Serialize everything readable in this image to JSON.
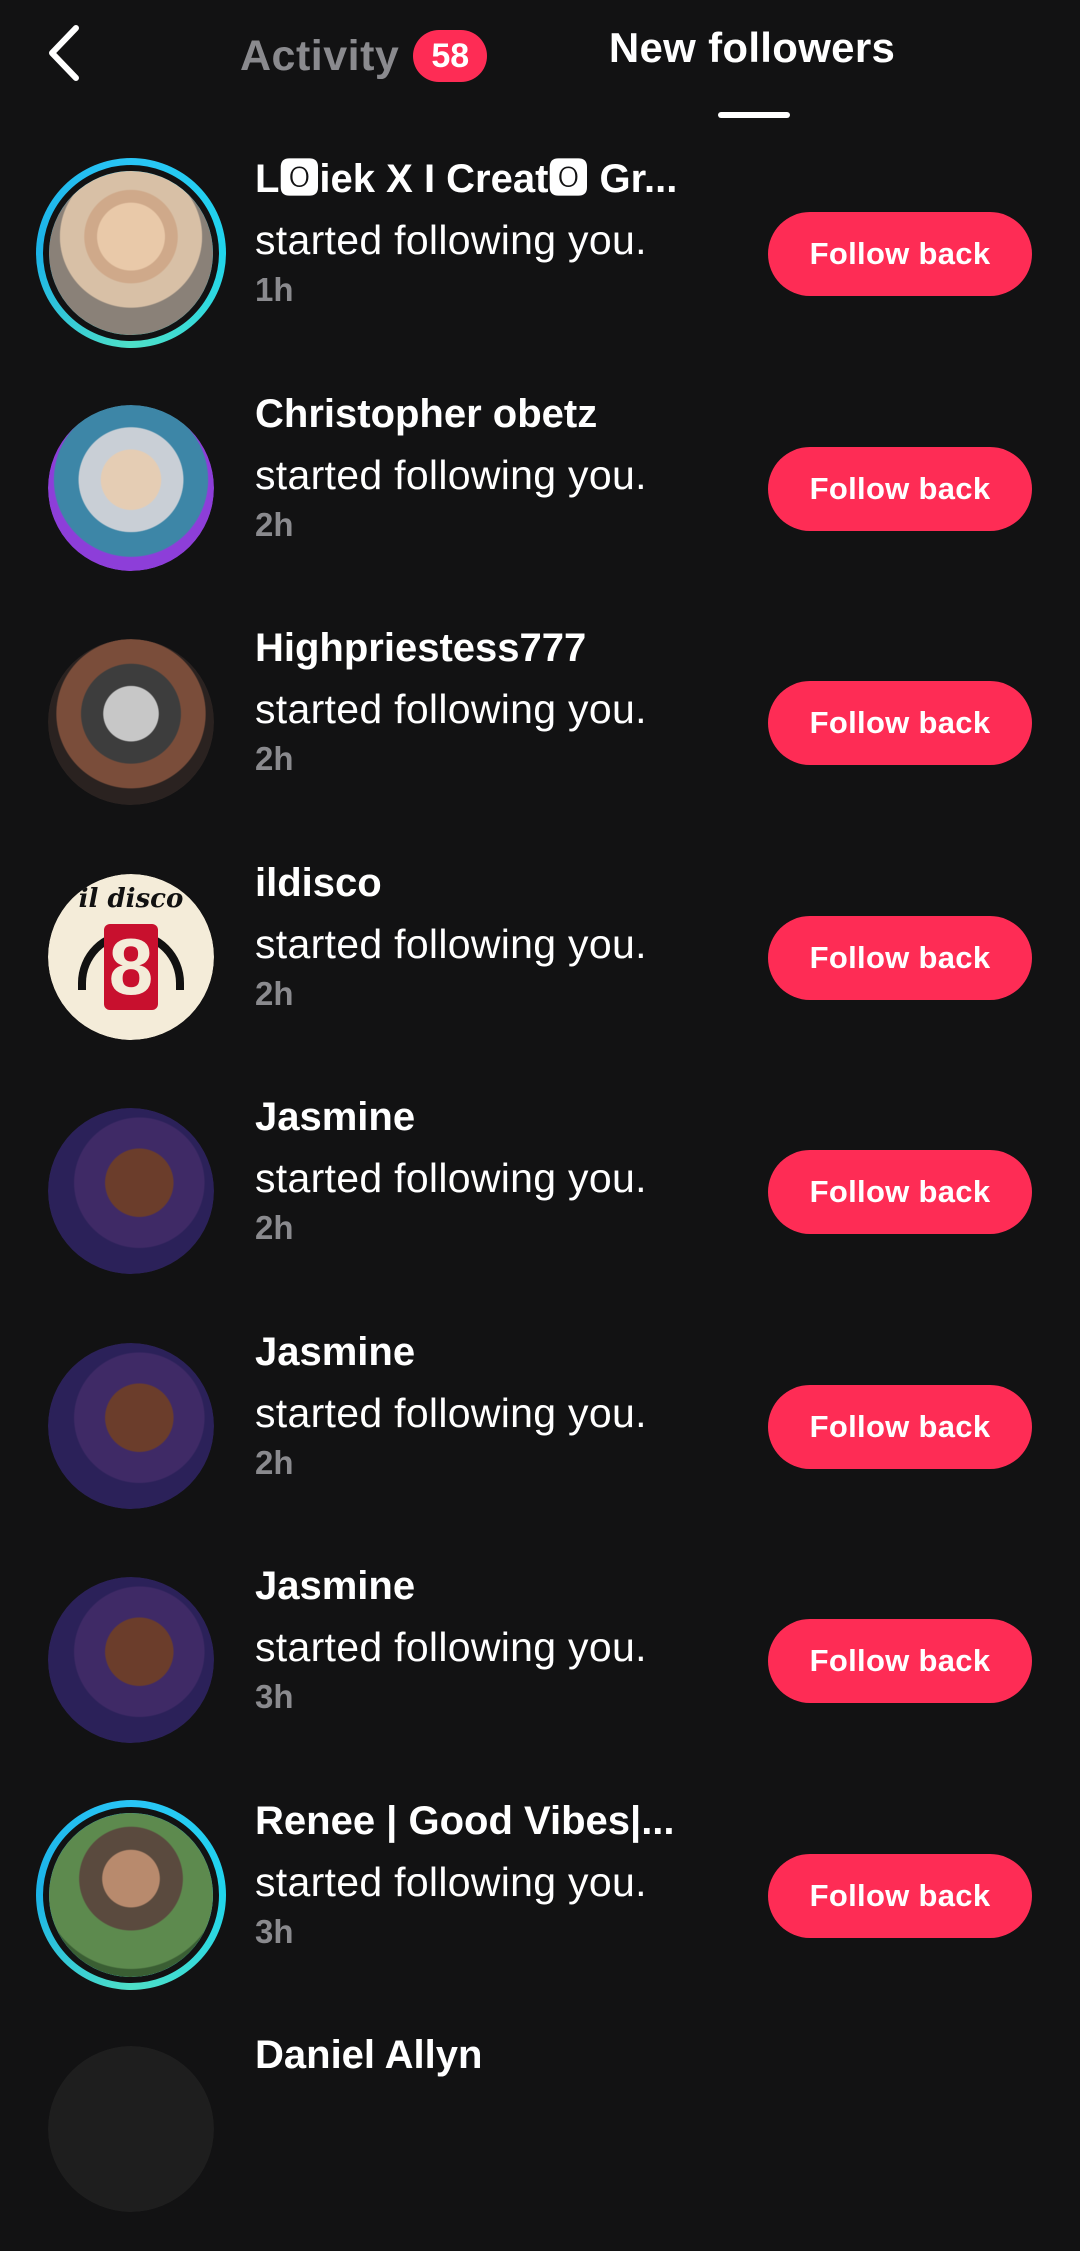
{
  "header": {
    "activity_label": "Activity",
    "activity_badge": "58",
    "new_followers_label": "New followers",
    "back_icon": "chevron-left-icon"
  },
  "colors": {
    "background": "#121213",
    "accent": "#fe2c55",
    "muted_text": "#8a8a8e",
    "story_ring": "#29c5f6"
  },
  "followers": [
    {
      "name": "L🅾iek X I Creat🅾 Gr...",
      "action": "started following you.",
      "time": "1h",
      "button": "Follow back"
    },
    {
      "name": "Christopher obetz",
      "action": "started following you.",
      "time": "2h",
      "button": "Follow back"
    },
    {
      "name": "Highpriestess777",
      "action": "started following you.",
      "time": "2h",
      "button": "Follow back"
    },
    {
      "name": "ildisco",
      "action": "started following you.",
      "time": "2h",
      "button": "Follow back",
      "avatar_text": "il disco"
    },
    {
      "name": "Jasmine",
      "action": "started following you.",
      "time": "2h",
      "button": "Follow back"
    },
    {
      "name": "Jasmine",
      "action": "started following you.",
      "time": "2h",
      "button": "Follow back"
    },
    {
      "name": "Jasmine",
      "action": "started following you.",
      "time": "3h",
      "button": "Follow back"
    },
    {
      "name": "Renee | Good Vibes|...",
      "action": "started following you.",
      "time": "3h",
      "button": "Follow back"
    },
    {
      "name": "Daniel Allyn"
    }
  ]
}
